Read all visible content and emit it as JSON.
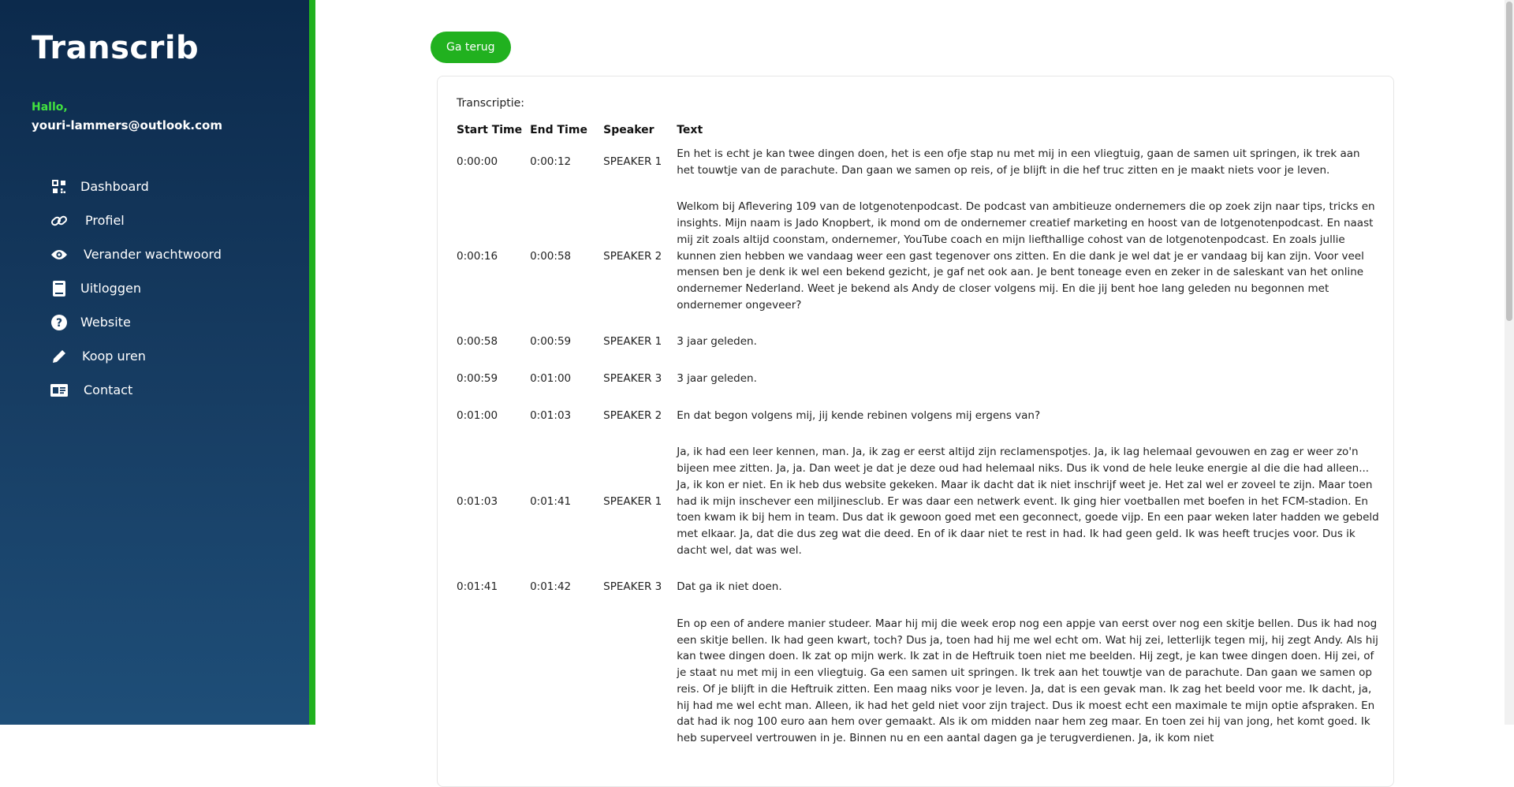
{
  "app": {
    "title": "Transcrib"
  },
  "user": {
    "greeting": "Hallo,",
    "email": "youri-lammers@outlook.com"
  },
  "nav": [
    {
      "label": "Dashboard",
      "icon": "grid-icon"
    },
    {
      "label": "Profiel",
      "icon": "link-icon"
    },
    {
      "label": "Verander wachtwoord",
      "icon": "eye-icon"
    },
    {
      "label": "Uitloggen",
      "icon": "book-icon"
    },
    {
      "label": "Website",
      "icon": "help-icon"
    },
    {
      "label": "Koop uren",
      "icon": "pencil-icon"
    },
    {
      "label": "Contact",
      "icon": "contact-card-icon"
    }
  ],
  "actions": {
    "back": "Ga terug"
  },
  "transcript": {
    "title": "Transcriptie:",
    "headers": [
      "Start Time",
      "End Time",
      "Speaker",
      "Text"
    ],
    "rows": [
      {
        "start": "0:00:00",
        "end": "0:00:12",
        "speaker": "SPEAKER 1",
        "text": "En het is echt je kan twee dingen doen, het is een ofje stap nu met mij in een vliegtuig, gaan de samen uit springen, ik trek aan het touwtje van de parachute. Dan gaan we samen op reis, of je blijft in die hef truc zitten en je maakt niets voor je leven."
      },
      {
        "start": "0:00:16",
        "end": "0:00:58",
        "speaker": "SPEAKER 2",
        "text": "Welkom bij Aflevering 109 van de lotgenotenpodcast. De podcast van ambitieuze ondernemers die op zoek zijn naar tips, tricks en insights. Mijn naam is Jado Knopbert, ik mond om de ondernemer creatief marketing en hoost van de lotgenotenpodcast. En naast mij zit zoals altijd coonstam, ondernemer, YouTube coach en mijn liefthallige cohost van de lotgenotenpodcast. En zoals jullie kunnen zien hebben we vandaag weer een gast tegenover ons zitten. En die dank je wel dat je er vandaag bij kan zijn. Voor veel mensen ben je denk ik wel een bekend gezicht, je gaf net ook aan. Je bent toneage even en zeker in de saleskant van het online ondernemer Nederland. Weet je bekend als Andy de closer volgens mij. En die jij bent hoe lang geleden nu begonnen met ondernemer ongeveer?"
      },
      {
        "start": "0:00:58",
        "end": "0:00:59",
        "speaker": "SPEAKER 1",
        "text": "3 jaar geleden."
      },
      {
        "start": "0:00:59",
        "end": "0:01:00",
        "speaker": "SPEAKER 3",
        "text": "3 jaar geleden."
      },
      {
        "start": "0:01:00",
        "end": "0:01:03",
        "speaker": "SPEAKER 2",
        "text": "En dat begon volgens mij, jij kende rebinen volgens mij ergens van?"
      },
      {
        "start": "0:01:03",
        "end": "0:01:41",
        "speaker": "SPEAKER 1",
        "text": "Ja, ik had een leer kennen, man. Ja, ik zag er eerst altijd zijn reclamenspotjes. Ja, ik lag helemaal gevouwen en zag er weer zo'n bijeen mee zitten. Ja, ja. Dan weet je dat je deze oud had helemaal niks. Dus ik vond de hele leuke energie al die die had alleen... Ja, ik kon er niet. En ik heb dus website gekeken. Maar ik dacht dat ik niet inschrijf weet je. Het zal wel er zoveel te zijn. Maar toen had ik mijn inschever een miljinesclub. Er was daar een netwerk event. Ik ging hier voetballen met boefen in het FCM-stadion. En toen kwam ik bij hem in team. Dus dat ik gewoon goed met een geconnect, goede vijp. En een paar weken later hadden we gebeld met elkaar. Ja, dat die dus zeg wat die deed. En of ik daar niet te rest in had. Ik had geen geld. Ik was heeft trucjes voor. Dus ik dacht wel, dat was wel."
      },
      {
        "start": "0:01:41",
        "end": "0:01:42",
        "speaker": "SPEAKER 3",
        "text": "Dat ga ik niet doen."
      },
      {
        "start": "",
        "end": "",
        "speaker": "",
        "text": "En op een of andere manier studeer. Maar hij mij die week erop nog een appje van eerst over nog een skitje bellen. Dus ik had nog een skitje bellen. Ik had geen kwart, toch? Dus ja, toen had hij me wel echt om. Wat hij zei, letterlijk tegen mij, hij zegt Andy. Als hij kan twee dingen doen. Ik zat op mijn werk. Ik zat in de Heftruik toen niet me beelden. Hij zegt, je kan twee dingen doen. Hij zei, of je staat nu met mij in een vliegtuig. Ga een samen uit springen. Ik trek aan het touwtje van de parachute. Dan gaan we samen op reis. Of je blijft in die Heftruik zitten. Een maag niks voor je leven. Ja, dat is een gevak man. Ik zag het beeld voor me. Ik dacht, ja, hij had me wel echt man. Alleen, ik had het geld niet voor zijn traject. Dus ik moest echt een maximale te mijn optie afspraken. En dat had ik nog 100 euro aan hem over gemaakt. Als ik om midden naar hem zeg maar. En toen zei hij van jong, het komt goed. Ik heb superveel vertrouwen in je. Binnen nu en een aantal dagen ga je terugverdienen. Ja, ik kom niet"
      }
    ]
  }
}
